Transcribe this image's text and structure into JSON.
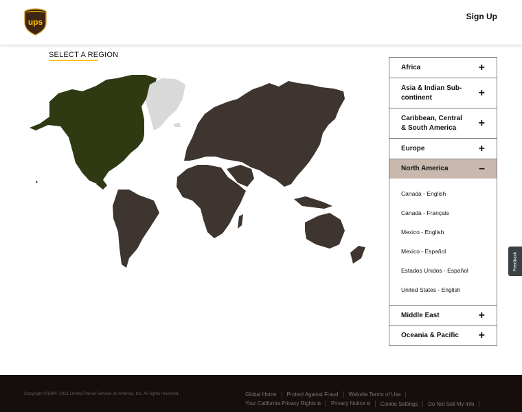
{
  "header": {
    "logo_text": "ups",
    "signup_label": "Sign Up"
  },
  "section_title": "SELECT A REGION",
  "colors": {
    "brand_brown": "#3f3530",
    "brand_gold": "#ffc400",
    "selected_region": "#2f3a12",
    "inactive_region": "#d9d9d9",
    "active_accordion": "#c8b8ad"
  },
  "regions": [
    {
      "label": "Africa",
      "sign": "+"
    },
    {
      "label": "Asia & Indian Sub-continent",
      "sign": "+"
    },
    {
      "label": "Caribbean, Central & South America",
      "sign": "+"
    },
    {
      "label": "Europe",
      "sign": "+"
    },
    {
      "label": "North America",
      "sign": "–"
    },
    {
      "label": "Middle East",
      "sign": "+"
    },
    {
      "label": "Oceania & Pacific",
      "sign": "+"
    }
  ],
  "north_america_links": [
    "Canada - English",
    "Canada - Français",
    "Mexico - English",
    "Mexico - Español",
    "Estados Unidos - Español",
    "United States - English"
  ],
  "feedback_label": "Feedback",
  "footer": {
    "copyright": "Copyright ©1994- 2021 United Parcel Service of America, Inc. All rights reserved.",
    "row1": [
      "Global Home",
      "Protect Against Fraud",
      "Website Terms of Use"
    ],
    "row2": [
      "Your California Privacy Rights",
      "Privacy Notice",
      "Cookie Settings",
      "Do Not Sell My Info"
    ]
  }
}
